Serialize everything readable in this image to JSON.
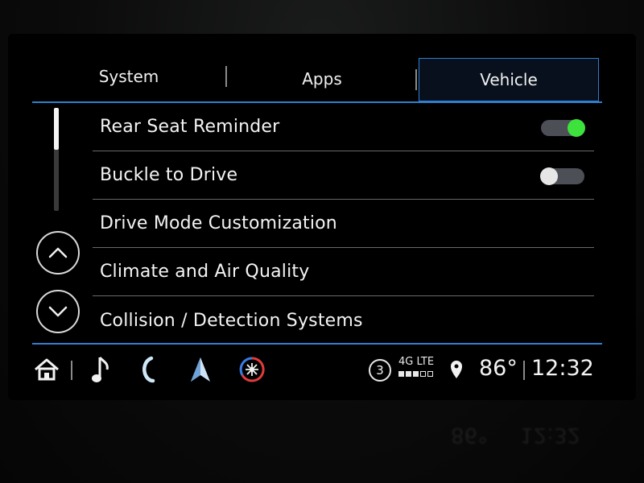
{
  "tabs": [
    {
      "label": "System",
      "active": false
    },
    {
      "label": "Apps",
      "active": false
    },
    {
      "label": "Vehicle",
      "active": true
    }
  ],
  "list": {
    "items": [
      {
        "label": "Rear Seat Reminder",
        "toggle": "on"
      },
      {
        "label": "Buckle to Drive",
        "toggle": "off"
      },
      {
        "label": "Drive Mode Customization"
      },
      {
        "label": "Climate and Air Quality"
      },
      {
        "label": "Collision / Detection Systems"
      }
    ]
  },
  "status": {
    "notification_count": "3",
    "network": "4G LTE",
    "signal_bars": 3,
    "signal_bars_total": 5,
    "temperature": "86°",
    "time": "12:32"
  },
  "icons": {
    "home": "home-icon",
    "music": "music-note-icon",
    "phone": "phone-icon",
    "navigation": "navigation-arrow-icon",
    "climate": "climate-fan-icon",
    "location": "location-pin-icon"
  },
  "colors": {
    "accent": "#2f7fd0",
    "toggle_on": "#3ee23c",
    "climate_red": "#e23b3b"
  },
  "reflection": {
    "temperature": "86°",
    "time": "12:32"
  }
}
